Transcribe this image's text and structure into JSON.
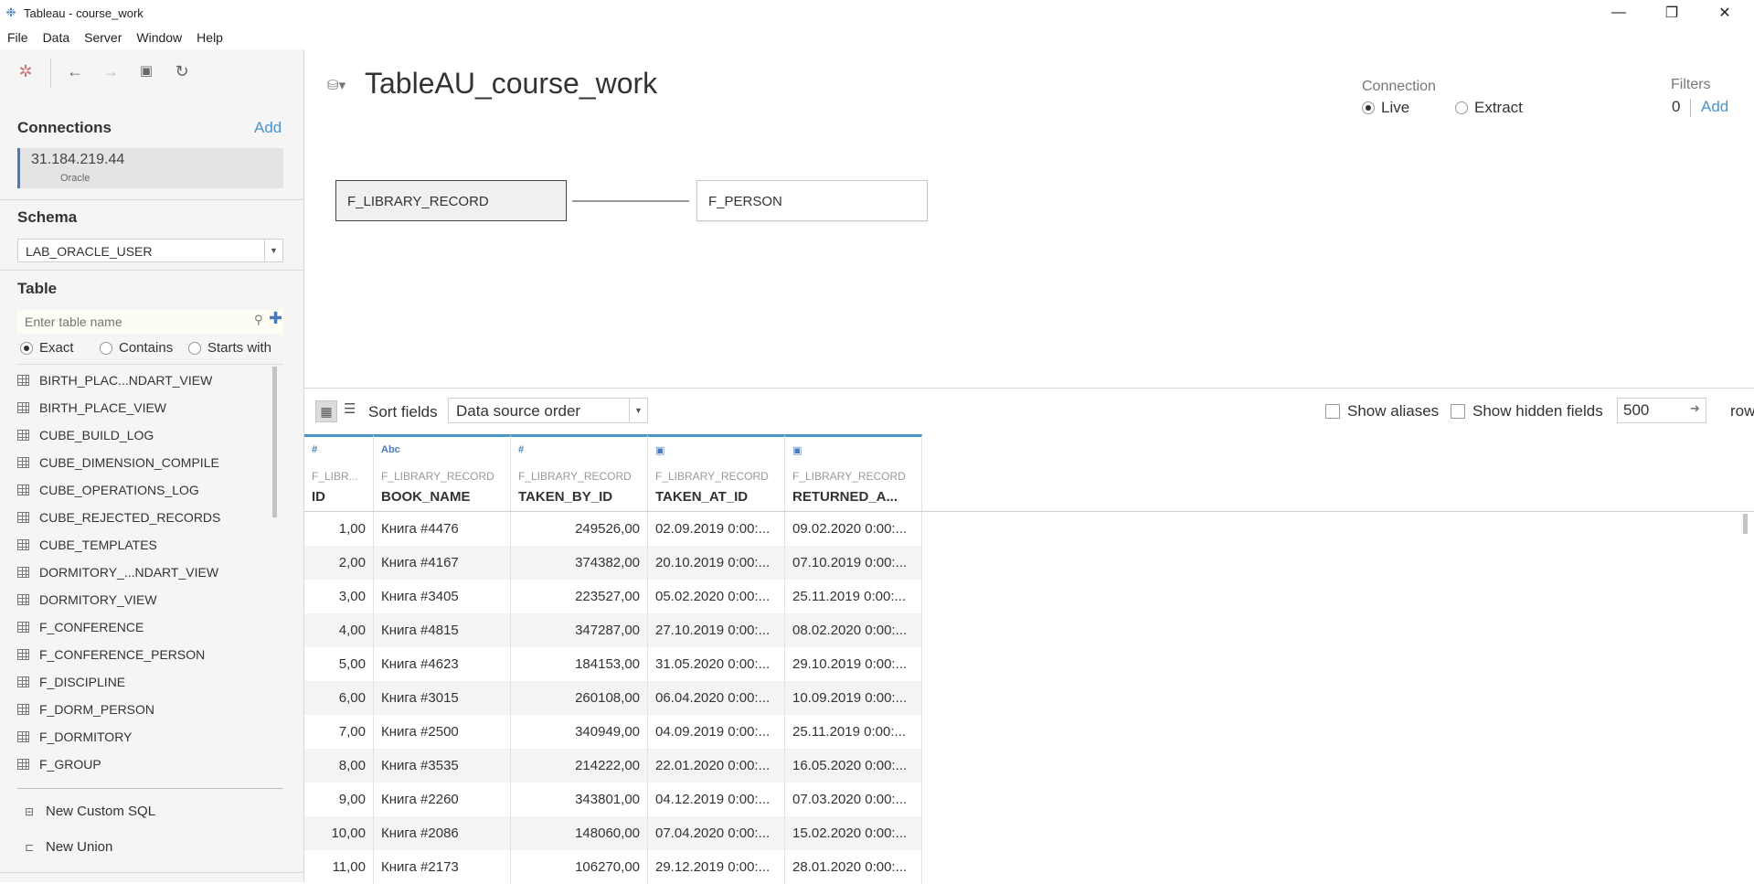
{
  "window": {
    "title": "Tableau - course_work"
  },
  "menu": [
    "File",
    "Data",
    "Server",
    "Window",
    "Help"
  ],
  "left": {
    "connections_title": "Connections",
    "connections_add": "Add",
    "connection": {
      "host": "31.184.219.44",
      "type": "Oracle"
    },
    "schema_title": "Schema",
    "schema_value": "LAB_ORACLE_USER",
    "table_title": "Table",
    "search_placeholder": "Enter table name",
    "match_options": [
      "Exact",
      "Contains",
      "Starts with"
    ],
    "selected_match": "Exact",
    "tables": [
      "BIRTH_PLAC...NDART_VIEW",
      "BIRTH_PLACE_VIEW",
      "CUBE_BUILD_LOG",
      "CUBE_DIMENSION_COMPILE",
      "CUBE_OPERATIONS_LOG",
      "CUBE_REJECTED_RECORDS",
      "CUBE_TEMPLATES",
      "DORMITORY_...NDART_VIEW",
      "DORMITORY_VIEW",
      "F_CONFERENCE",
      "F_CONFERENCE_PERSON",
      "F_DISCIPLINE",
      "F_DORM_PERSON",
      "F_DORMITORY",
      "F_GROUP"
    ],
    "new_custom_sql": "New Custom SQL",
    "new_union": "New Union"
  },
  "main": {
    "datasource_title": "TableAU_course_work",
    "connection_label": "Connection",
    "connection_live": "Live",
    "connection_extract": "Extract",
    "connection_selected": "Live",
    "filters_label": "Filters",
    "filters_count": "0",
    "filters_add": "Add",
    "join_left": "F_LIBRARY_RECORD",
    "join_right": "F_PERSON"
  },
  "grid": {
    "sort_label": "Sort fields",
    "sort_value": "Data source order",
    "show_aliases": "Show aliases",
    "show_hidden": "Show hidden fields",
    "rows_value": "500",
    "rows_label": "rows",
    "columns": [
      {
        "type_icon": "#",
        "source": "F_LIBR...",
        "field": "ID"
      },
      {
        "type_icon": "Abc",
        "source": "F_LIBRARY_RECORD",
        "field": "BOOK_NAME"
      },
      {
        "type_icon": "#",
        "source": "F_LIBRARY_RECORD",
        "field": "TAKEN_BY_ID"
      },
      {
        "type_icon": "date",
        "source": "F_LIBRARY_RECORD",
        "field": "TAKEN_AT_ID"
      },
      {
        "type_icon": "date",
        "source": "F_LIBRARY_RECORD",
        "field": "RETURNED_A..."
      }
    ],
    "rows": [
      [
        "1,00",
        "Книга #4476",
        "249526,00",
        "02.09.2019 0:00:...",
        "09.02.2020 0:00:..."
      ],
      [
        "2,00",
        "Книга #4167",
        "374382,00",
        "20.10.2019 0:00:...",
        "07.10.2019 0:00:..."
      ],
      [
        "3,00",
        "Книга #3405",
        "223527,00",
        "05.02.2020 0:00:...",
        "25.11.2019 0:00:..."
      ],
      [
        "4,00",
        "Книга #4815",
        "347287,00",
        "27.10.2019 0:00:...",
        "08.02.2020 0:00:..."
      ],
      [
        "5,00",
        "Книга #4623",
        "184153,00",
        "31.05.2020 0:00:...",
        "29.10.2019 0:00:..."
      ],
      [
        "6,00",
        "Книга #3015",
        "260108,00",
        "06.04.2020 0:00:...",
        "10.09.2019 0:00:..."
      ],
      [
        "7,00",
        "Книга #2500",
        "340949,00",
        "04.09.2019 0:00:...",
        "25.11.2019 0:00:..."
      ],
      [
        "8,00",
        "Книга #3535",
        "214222,00",
        "22.01.2020 0:00:...",
        "16.05.2020 0:00:..."
      ],
      [
        "9,00",
        "Книга #2260",
        "343801,00",
        "04.12.2019 0:00:...",
        "07.03.2020 0:00:..."
      ],
      [
        "10,00",
        "Книга #2086",
        "148060,00",
        "07.04.2020 0:00:...",
        "15.02.2020 0:00:..."
      ],
      [
        "11,00",
        "Книга #2173",
        "106270,00",
        "29.12.2019 0:00:...",
        "28.01.2020 0:00:..."
      ]
    ]
  }
}
